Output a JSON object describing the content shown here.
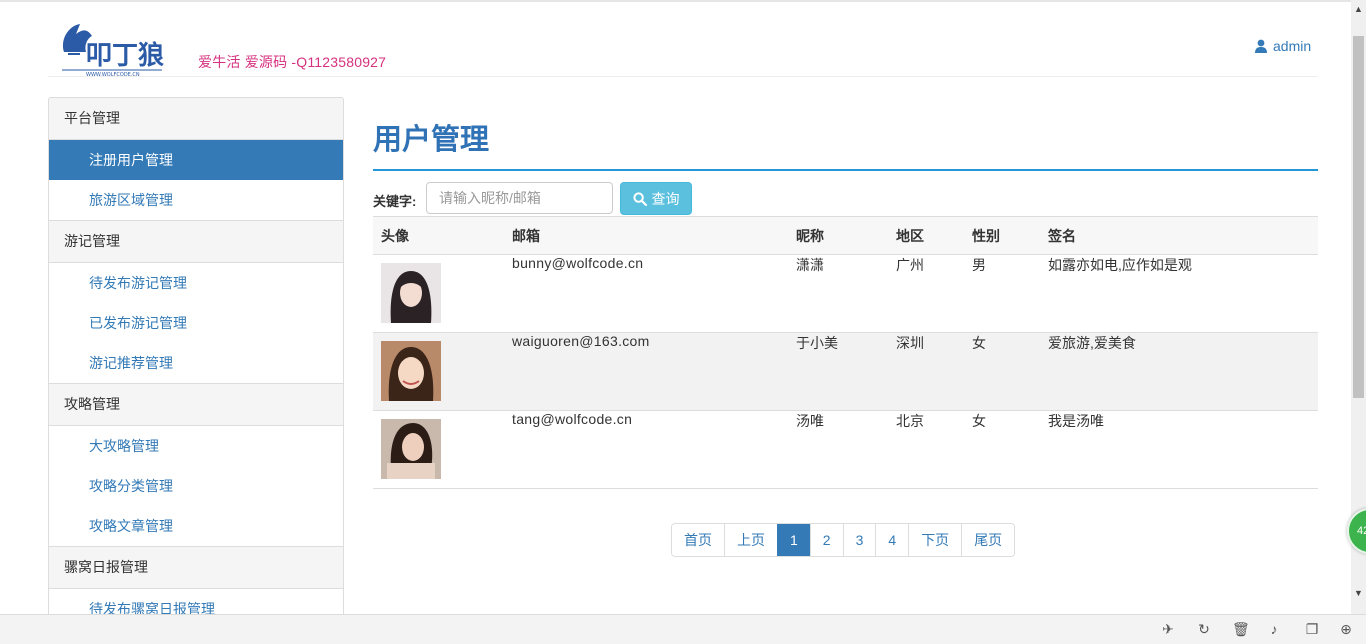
{
  "header": {
    "logo_alt": "叩丁狼",
    "logo_sub": "WWW.WOLFCODE.CN",
    "slogan": "爱牛活 爱源码 -Q1123580927",
    "user": "admin"
  },
  "sidebar": {
    "groups": [
      {
        "title": "平台管理",
        "items": [
          "注册用户管理",
          "旅游区域管理"
        ]
      },
      {
        "title": "游记管理",
        "items": [
          "待发布游记管理",
          "已发布游记管理",
          "游记推荐管理"
        ]
      },
      {
        "title": "攻略管理",
        "items": [
          "大攻略管理",
          "攻略分类管理",
          "攻略文章管理"
        ]
      },
      {
        "title": "骡窝日报管理",
        "items": [
          "待发布骡窝日报管理"
        ]
      }
    ],
    "active_item": "注册用户管理"
  },
  "main": {
    "title": "用户管理",
    "search": {
      "label": "关键字:",
      "placeholder": "请输入昵称/邮箱",
      "value": "",
      "button": "查询"
    },
    "table": {
      "headers": [
        "头像",
        "邮箱",
        "昵称",
        "地区",
        "性别",
        "签名"
      ],
      "rows": [
        {
          "email": "bunny@wolfcode.cn",
          "nickname": "潇潇",
          "region": "广州",
          "gender": "男",
          "signature": "如露亦如电,应作如是观"
        },
        {
          "email": "waiguoren@163.com",
          "nickname": "于小美",
          "region": "深圳",
          "gender": "女",
          "signature": "爱旅游,爱美食"
        },
        {
          "email": "tang@wolfcode.cn",
          "nickname": "汤唯",
          "region": "北京",
          "gender": "女",
          "signature": "我是汤唯"
        }
      ]
    },
    "pagination": {
      "first": "首页",
      "prev": "上页",
      "pages": [
        "1",
        "2",
        "3",
        "4"
      ],
      "current": "1",
      "next": "下页",
      "last": "尾页"
    }
  },
  "floatball": {
    "text": "42"
  },
  "colors": {
    "primary": "#337ab7",
    "title": "#2f72b5",
    "rule": "#2596d9",
    "info_button": "#5bc0de",
    "slogan": "#d6317f"
  }
}
